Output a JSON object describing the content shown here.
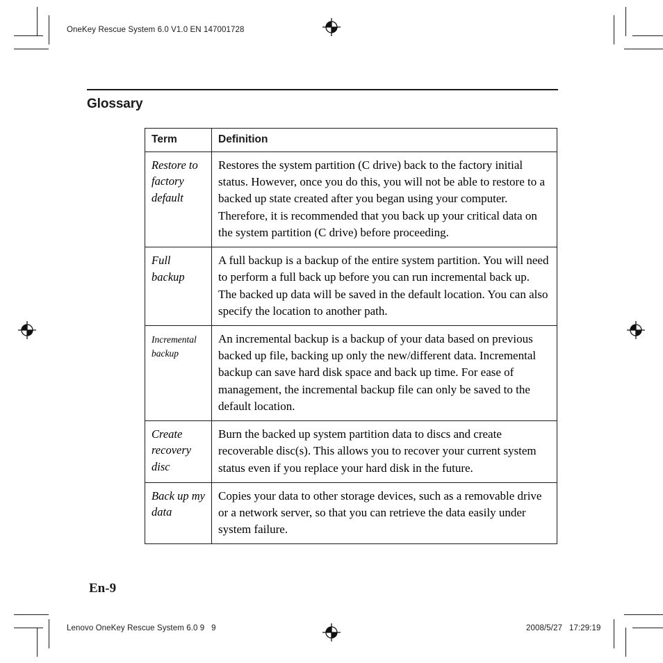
{
  "header": {
    "running_head": "OneKey Rescue System 6.0 V1.0 EN 147001728"
  },
  "content": {
    "section_title": "Glossary"
  },
  "table": {
    "columns": [
      "Term",
      "Definition"
    ],
    "rows": [
      {
        "term": "Restore to factory default",
        "term_size": "normal",
        "definition": "Restores the system partition (C drive) back to the factory initial status. However, once you do this, you will not be able to restore to a backed up state created after you began using your computer. Therefore, it is recommended that you back up your critical data on the system partition (C drive) before proceeding."
      },
      {
        "term": "Full backup",
        "term_size": "normal",
        "definition": "A full backup is a backup of the entire system partition. You will need to perform a full back up before you can run incremental back up. The backed up data will be saved in the default location. You can also specify the location to another path."
      },
      {
        "term": "Incremental backup",
        "term_size": "small",
        "definition": "An incremental backup is a backup of your data based on previous backed up file, backing up only the new/different data. Incremental backup can save hard disk space and back up time. For ease of management, the incremental backup file can only be saved to the default location."
      },
      {
        "term": "Create recovery disc",
        "term_size": "normal",
        "definition": "Burn the backed up system partition data to discs and create recoverable disc(s). This allows you to recover your current system status even if you replace your hard disk in the future."
      },
      {
        "term": "Back up my data",
        "term_size": "normal",
        "definition": "Copies your data to other storage devices, such as a removable drive or a network server, so that you can retrieve the data easily under system failure."
      }
    ]
  },
  "folio": {
    "page_label": "En-9"
  },
  "footer": {
    "left": "Lenovo OneKey Rescue System 6.0 9   9",
    "right": "2008/5/27   17:29:19"
  },
  "colors": {
    "ink": "#1a1a1a",
    "paper": "#ffffff"
  }
}
